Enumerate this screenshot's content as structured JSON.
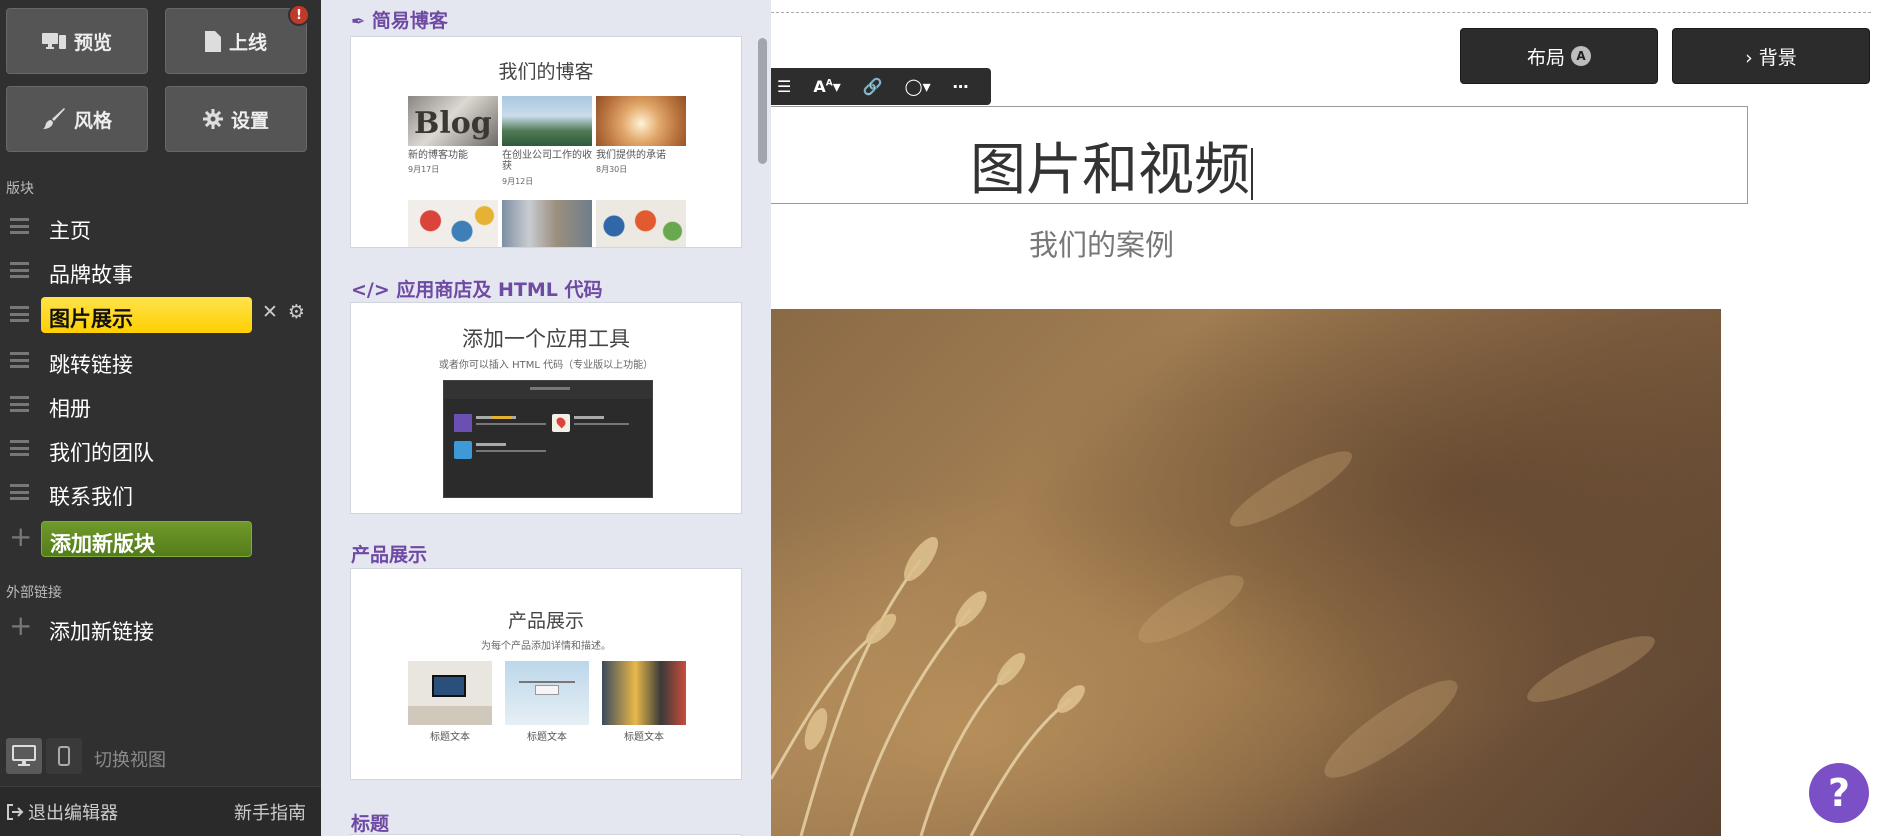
{
  "sidebar": {
    "buttons": {
      "preview": "预览",
      "publish": "上线",
      "publish_badge": "!",
      "style": "风格",
      "settings": "设置"
    },
    "sections_heading": "版块",
    "sections": [
      {
        "label": "主页"
      },
      {
        "label": "品牌故事"
      },
      {
        "label": "图片展示",
        "active": true
      },
      {
        "label": "跳转链接"
      },
      {
        "label": "相册"
      },
      {
        "label": "我们的团队"
      },
      {
        "label": "联系我们"
      }
    ],
    "add_section": "添加新版块",
    "external_heading": "外部链接",
    "add_link": "添加新链接",
    "switch_view": "切换视图",
    "exit_editor": "退出编辑器",
    "guide": "新手指南"
  },
  "library": {
    "blog": {
      "category": "简易博客",
      "card_title": "我们的博客",
      "posts": [
        {
          "caption": "新的博客功能",
          "date": "9月17日"
        },
        {
          "caption": "在创业公司工作的收获",
          "date": "9月12日"
        },
        {
          "caption": "我们提供的承诺",
          "date": "8月30日"
        }
      ]
    },
    "app": {
      "category": "应用商店及 HTML 代码",
      "card_title": "添加一个应用工具",
      "card_sub": "或者你可以插入 HTML 代码（专业版以上功能）"
    },
    "product": {
      "category": "产品展示",
      "card_title": "产品展示",
      "card_sub": "为每个产品添加详情和描述。",
      "items": [
        "标题文本",
        "标题文本",
        "标题文本"
      ]
    },
    "heading": {
      "category": "标题"
    }
  },
  "canvas": {
    "layout_button": "布局",
    "layout_badge": "A",
    "background_button": "› 背景",
    "title": "图片和视频",
    "subtitle": "我们的案例",
    "help": "?"
  },
  "colors": {
    "sidebar_bg": "#303030",
    "active_section": "#ffd21a",
    "add_section": "#5f8a22",
    "category_title": "#6f4aa5",
    "help_button": "#7b4fc6"
  }
}
